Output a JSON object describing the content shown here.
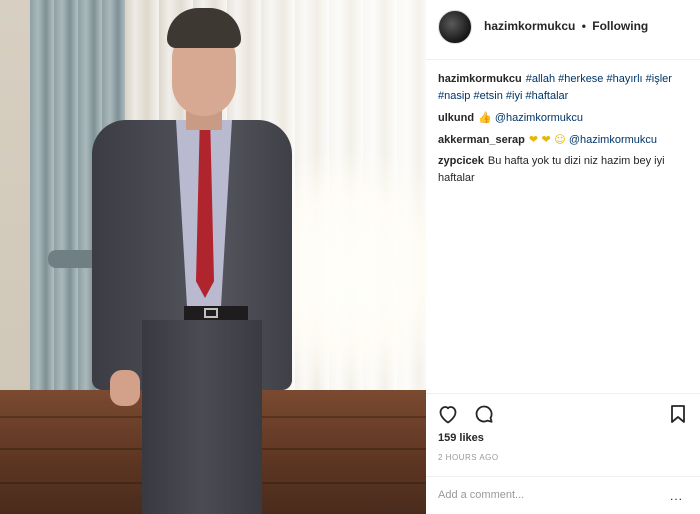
{
  "post": {
    "image_alt": "man in grey suit with red tie standing by curtains"
  },
  "header": {
    "username": "hazimkormukcu",
    "separator": "•",
    "follow_status": "Following"
  },
  "caption": {
    "username": "hazimkormukcu",
    "hashtags": [
      "#allah",
      "#herkese",
      "#hayırlı",
      "#işler",
      "#nasip",
      "#etsin",
      "#iyi",
      "#haftalar"
    ]
  },
  "comments": [
    {
      "username": "ulkund",
      "emoji": "👍",
      "text": "",
      "mention": "@hazimkormukcu"
    },
    {
      "username": "akkerman_serap",
      "emoji": "❤ ❤ ☺",
      "text": "",
      "mention": "@hazimkormukcu"
    },
    {
      "username": "zypcicek",
      "emoji": "",
      "text": "Bu hafta yok tu dizi niz hazim bey iyi haftalar",
      "mention": ""
    }
  ],
  "actions": {
    "like_icon": "heart-icon",
    "comment_icon": "comment-bubble-icon",
    "save_icon": "bookmark-icon"
  },
  "likes": "159 likes",
  "timestamp": "2 HOURS AGO",
  "add_comment": {
    "placeholder": "Add a comment...",
    "more_label": "..."
  },
  "colors": {
    "text": "#262626",
    "link": "#003569",
    "muted": "#999999",
    "divider": "#efefef"
  }
}
